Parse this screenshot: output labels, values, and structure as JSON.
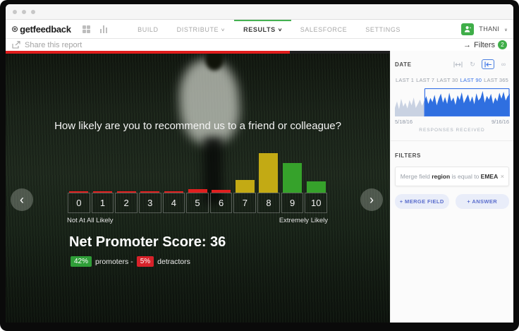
{
  "icons": {
    "logo_glyph": "⊛",
    "caret_down": "∨",
    "share_glyph": "↗",
    "filters_arrow": "→",
    "refresh_glyph": "↻",
    "infinity_glyph": "∞",
    "close_glyph": "×",
    "arrow_left_glyph": "‹",
    "arrow_right_glyph": "›"
  },
  "colors": {
    "brand_green": "#3fae49",
    "accent_blue": "#3b74e8",
    "progress_red": "#e01d1d"
  },
  "nav": {
    "logo_text": "getfeedback",
    "items": [
      {
        "label": "BUILD",
        "caret": false,
        "active": false
      },
      {
        "label": "DISTRIBUTE",
        "caret": true,
        "active": false
      },
      {
        "label": "RESULTS",
        "caret": true,
        "active": true
      },
      {
        "label": "SALESFORCE",
        "caret": false,
        "active": false
      },
      {
        "label": "SETTINGS",
        "caret": false,
        "active": false
      }
    ],
    "user": {
      "name": "THANI"
    }
  },
  "share_bar": {
    "share_label": "Share this report",
    "filters_label": "Filters",
    "filters_count": "2"
  },
  "survey": {
    "progress_percent": 74,
    "question": "How likely are you to recommend us to a friend or colleague?",
    "scale_left_label": "Not At All Likely",
    "scale_right_label": "Extremely Likely",
    "nps_title": "Net Promoter Score: 36",
    "promoters_pct": "42%",
    "promoters_label": "promoters -",
    "detractors_pct": "5%",
    "detractors_label": "detractors"
  },
  "chart_data": [
    {
      "type": "bar",
      "title": "How likely are you to recommend us to a friend or colleague?",
      "categories": [
        "0",
        "1",
        "2",
        "3",
        "4",
        "5",
        "6",
        "7",
        "8",
        "9",
        "10"
      ],
      "values": [
        2,
        2,
        2,
        2,
        2,
        5,
        4,
        18,
        56,
        42,
        16
      ],
      "units": "relative bar height (no value axis shown)",
      "colors": [
        "#e01f1f",
        "#e01f1f",
        "#e01f1f",
        "#e01f1f",
        "#e01f1f",
        "#e01f1f",
        "#e01f1f",
        "#c3aa14",
        "#c3aa14",
        "#36a22b",
        "#36a22b"
      ],
      "xlabel": "",
      "ylabel": "",
      "legend": "none",
      "annotations": [
        "Net Promoter Score: 36",
        "42% promoters - 5% detractors"
      ]
    },
    {
      "type": "area",
      "title": "RESPONSES RECEIVED",
      "x_start_label": "5/18/16",
      "x_end_label": "9/16/16",
      "selection_start_frac": 0.26,
      "selection_end_frac": 1.0,
      "values": [
        0.3,
        0.55,
        0.25,
        0.65,
        0.35,
        0.5,
        0.28,
        0.6,
        0.4,
        0.7,
        0.3,
        0.45,
        0.62,
        0.38,
        0.55,
        0.75,
        0.45,
        0.68,
        0.52,
        0.8,
        0.4,
        0.65,
        0.85,
        0.5,
        0.72,
        0.45,
        0.88,
        0.55,
        0.7,
        0.42,
        0.78,
        0.6,
        0.9,
        0.48,
        0.66,
        0.82,
        0.52,
        0.74,
        0.44,
        0.86,
        0.58,
        0.68,
        0.95,
        0.5,
        0.76,
        0.62,
        0.84,
        0.46,
        0.7,
        0.55,
        0.88,
        0.65,
        0.92,
        0.58,
        0.75,
        0.85
      ],
      "units": "relative response volume (no value axis shown)"
    }
  ],
  "sidebar": {
    "date": {
      "heading": "DATE",
      "ranges": [
        {
          "label": "LAST 1",
          "selected": false
        },
        {
          "label": "LAST 7",
          "selected": false
        },
        {
          "label": "LAST 30",
          "selected": false
        },
        {
          "label": "LAST 90",
          "selected": true
        },
        {
          "label": "LAST 365",
          "selected": false
        }
      ],
      "start_date": "5/18/16",
      "end_date": "9/16/16",
      "caption": "RESPONSES RECEIVED"
    },
    "filters": {
      "heading": "FILTERS",
      "rule": {
        "prefix": "Merge field",
        "field": "region",
        "operator": "is equal to",
        "value": "EMEA"
      },
      "merge_field_button": "+ MERGE FIELD",
      "answer_button": "+ ANSWER"
    }
  }
}
